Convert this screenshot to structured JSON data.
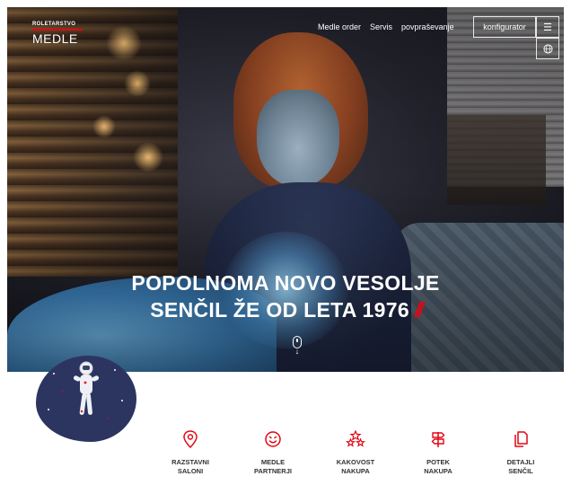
{
  "header": {
    "logo_top": "ROLETARSTVO",
    "logo_main": "MEDLE",
    "nav": [
      "Medle order",
      "Servis",
      "povpraševanje"
    ],
    "configurator_label": "konfigurator",
    "menu_glyph": "☰",
    "globe_icon": "globe-icon"
  },
  "hero": {
    "headline_line1": "POPOLNOMA NOVO VESOLJE",
    "headline_line2": "SENČIL ŽE OD LETA 1976",
    "slashes": "//",
    "accent_color": "#e30613",
    "scroll_arrow": "↓"
  },
  "features": [
    {
      "icon": "location-pin-icon",
      "label": "RAZSTAVNI\nSALONI"
    },
    {
      "icon": "smiley-icon",
      "label": "MEDLE\nPARTNERJI"
    },
    {
      "icon": "stars-icon",
      "label": "KAKOVOST\nNAKUPA"
    },
    {
      "icon": "signpost-icon",
      "label": "POTEK\nNAKUPA"
    },
    {
      "icon": "documents-icon",
      "label": "DETAJLI\nSENČIL"
    }
  ],
  "colors": {
    "accent": "#e30613",
    "blob": "#2c3560",
    "text": "#333333"
  }
}
